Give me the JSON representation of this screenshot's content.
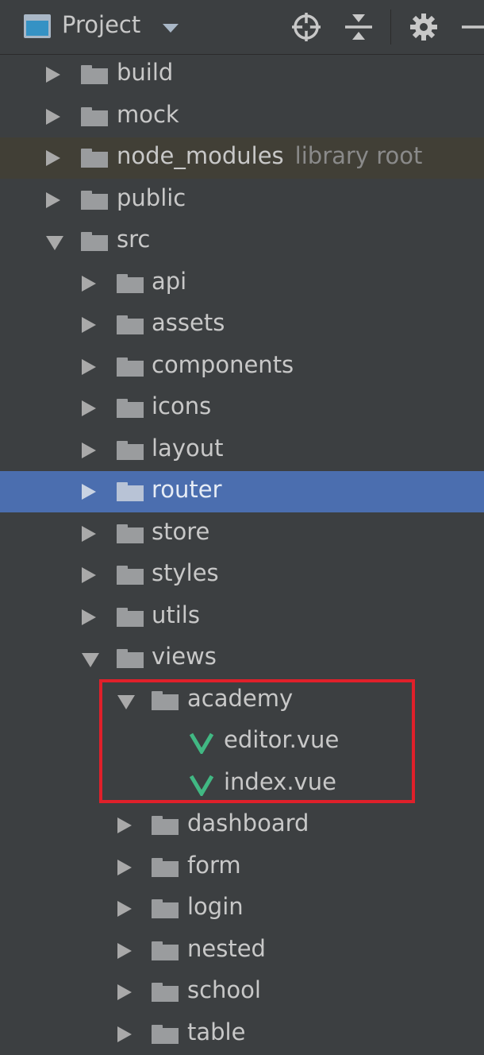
{
  "panel": {
    "title": "Project",
    "icons": [
      "project-window-icon",
      "dropdown-caret-icon",
      "locate-icon",
      "collapse-all-icon",
      "gear-icon",
      "minimize-icon"
    ]
  },
  "tree": [
    {
      "label": "build",
      "type": "folder",
      "expanded": false
    },
    {
      "label": "mock",
      "type": "folder",
      "expanded": false
    },
    {
      "label": "node_modules",
      "sub": "library root",
      "type": "folder",
      "expanded": false
    },
    {
      "label": "public",
      "type": "folder",
      "expanded": false
    },
    {
      "label": "src",
      "type": "folder",
      "expanded": true
    },
    {
      "label": "api",
      "type": "folder",
      "expanded": false
    },
    {
      "label": "assets",
      "type": "folder",
      "expanded": false
    },
    {
      "label": "components",
      "type": "folder",
      "expanded": false
    },
    {
      "label": "icons",
      "type": "folder",
      "expanded": false
    },
    {
      "label": "layout",
      "type": "folder",
      "expanded": false
    },
    {
      "label": "router",
      "type": "folder",
      "expanded": false,
      "selected": true
    },
    {
      "label": "store",
      "type": "folder",
      "expanded": false
    },
    {
      "label": "styles",
      "type": "folder",
      "expanded": false
    },
    {
      "label": "utils",
      "type": "folder",
      "expanded": false
    },
    {
      "label": "views",
      "type": "folder",
      "expanded": true
    },
    {
      "label": "academy",
      "type": "folder",
      "expanded": true
    },
    {
      "label": "editor.vue",
      "type": "vue-file"
    },
    {
      "label": "index.vue",
      "type": "vue-file"
    },
    {
      "label": "dashboard",
      "type": "folder",
      "expanded": false
    },
    {
      "label": "form",
      "type": "folder",
      "expanded": false
    },
    {
      "label": "login",
      "type": "folder",
      "expanded": false
    },
    {
      "label": "nested",
      "type": "folder",
      "expanded": false
    },
    {
      "label": "school",
      "type": "folder",
      "expanded": false
    },
    {
      "label": "table",
      "type": "folder",
      "expanded": false
    }
  ],
  "colors": {
    "background": "#3c3f41",
    "selection": "#4b6eaf",
    "library_highlight": "#413f36",
    "vue_green": "#41b883",
    "annotation_red": "#e0202a"
  }
}
